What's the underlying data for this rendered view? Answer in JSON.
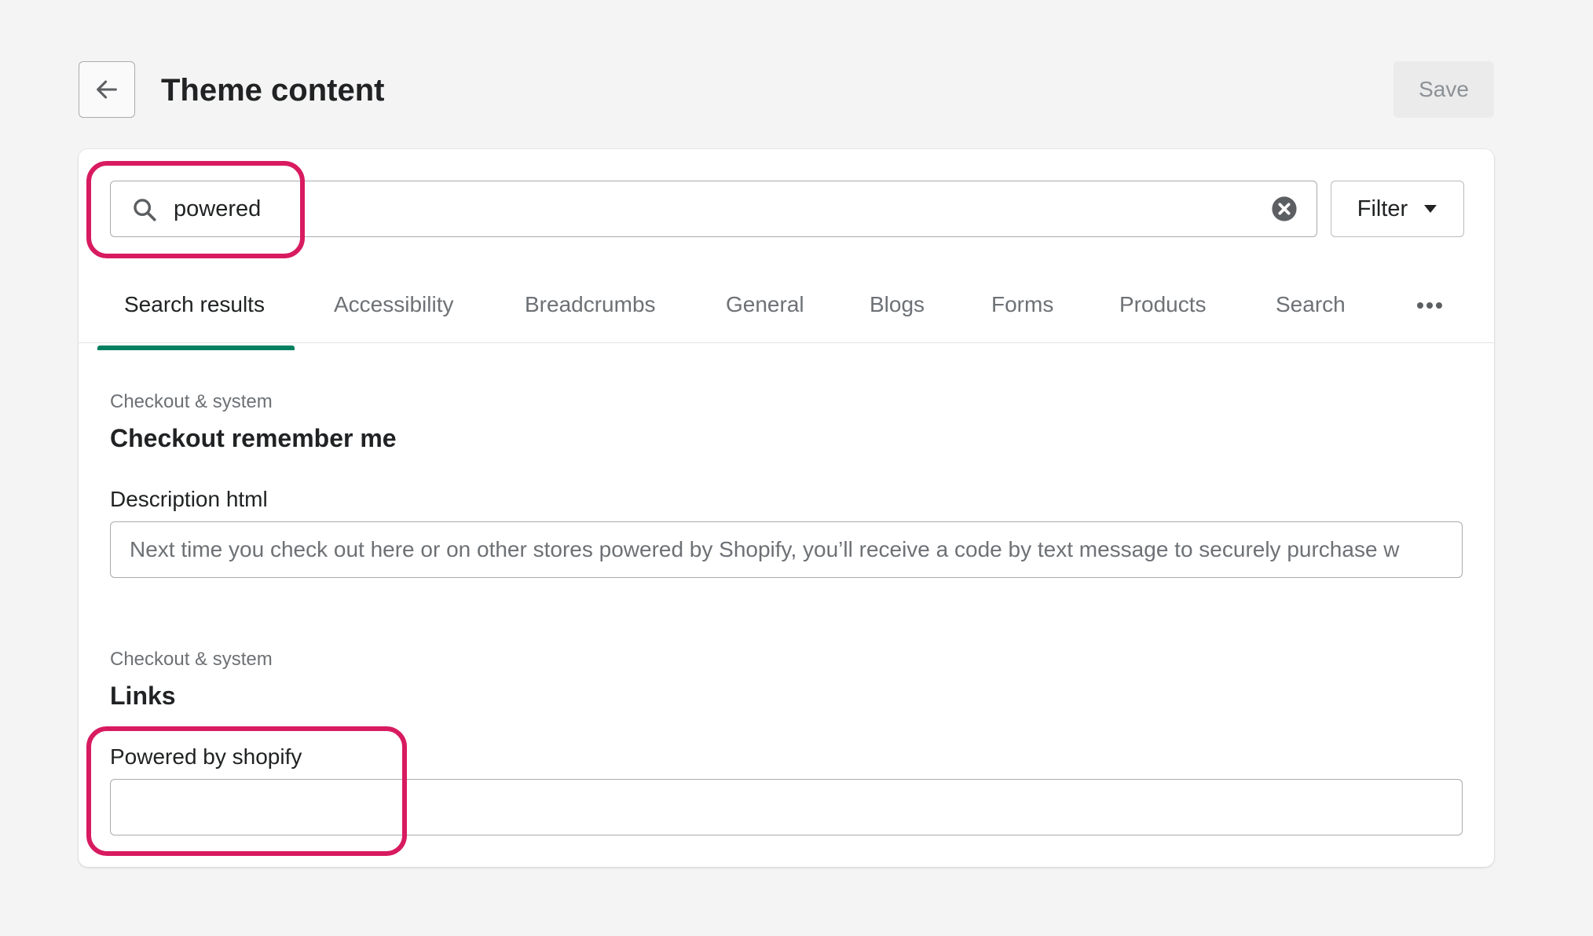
{
  "header": {
    "title": "Theme content",
    "save_label": "Save"
  },
  "search": {
    "value": "powered"
  },
  "filter": {
    "label": "Filter"
  },
  "tabs": [
    {
      "label": "Search results",
      "active": true
    },
    {
      "label": "Accessibility"
    },
    {
      "label": "Breadcrumbs"
    },
    {
      "label": "General"
    },
    {
      "label": "Blogs"
    },
    {
      "label": "Forms"
    },
    {
      "label": "Products"
    },
    {
      "label": "Search"
    }
  ],
  "results": [
    {
      "category": "Checkout & system",
      "title": "Checkout remember me",
      "field_label": "Description html",
      "field_value": "Next time you check out here or on other stores powered by Shopify, you’ll receive a code by text message to securely purchase w"
    },
    {
      "category": "Checkout & system",
      "title": "Links",
      "field_label": "Powered by shopify",
      "field_value": ""
    }
  ],
  "colors": {
    "accent": "#008060",
    "highlight": "#d81b60"
  }
}
